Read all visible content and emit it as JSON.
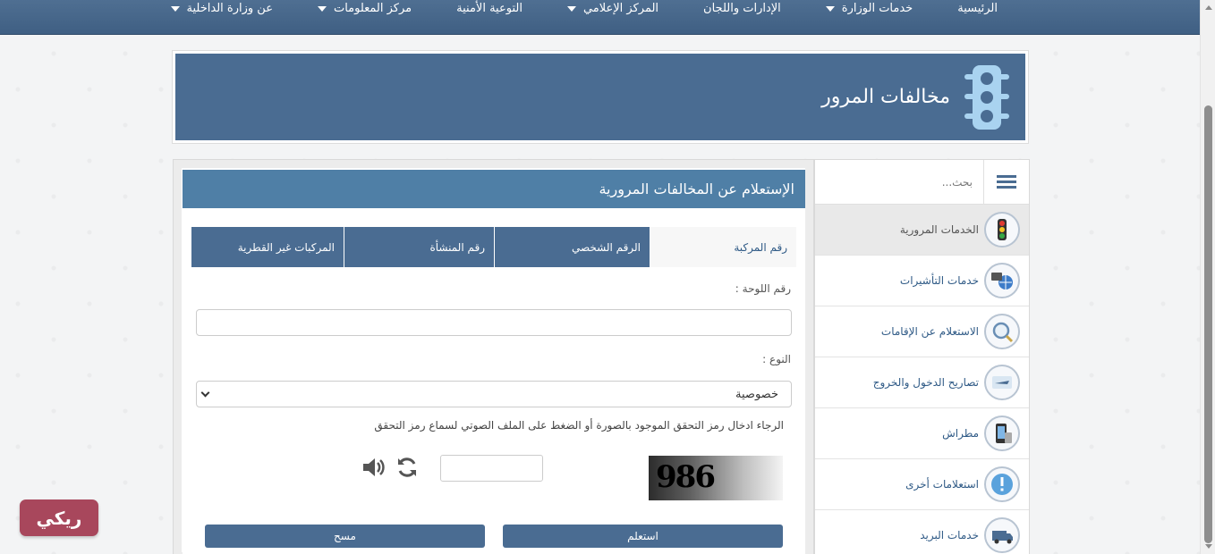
{
  "nav": {
    "items": [
      {
        "label": "الرئيسية",
        "has_caret": false
      },
      {
        "label": "خدمات الوزارة",
        "has_caret": true
      },
      {
        "label": "الإدارات واللجان",
        "has_caret": false
      },
      {
        "label": "المركز الإعلامي",
        "has_caret": true
      },
      {
        "label": "التوعية الأمنية",
        "has_caret": false
      },
      {
        "label": "مركز المعلومات",
        "has_caret": true
      },
      {
        "label": "عن وزارة الداخلية",
        "has_caret": true
      }
    ]
  },
  "banner": {
    "title": "مخالفات المرور",
    "icon": "traffic-light-icon"
  },
  "sidebar": {
    "search_placeholder": "بحث...",
    "items": [
      {
        "label": "الخدمات المرورية",
        "icon": "traffic-light-icon",
        "active": true
      },
      {
        "label": "خدمات التأشيرات",
        "icon": "visa-globe-icon",
        "active": false
      },
      {
        "label": "الاستعلام عن الإقامات",
        "icon": "residency-search-icon",
        "active": false
      },
      {
        "label": "تصاريح الدخول والخروج",
        "icon": "airplane-icon",
        "active": false
      },
      {
        "label": "مطراش",
        "icon": "metrash-phone-icon",
        "active": false
      },
      {
        "label": "استعلامات أخرى",
        "icon": "exclamation-icon",
        "active": false
      },
      {
        "label": "خدمات البريد",
        "icon": "postal-van-icon",
        "active": false
      }
    ]
  },
  "main": {
    "title": "الإستعلام عن المخالفات المرورية",
    "tabs": [
      {
        "label": "رقم المركبة",
        "active": true
      },
      {
        "label": "الرقم الشخصي",
        "active": false
      },
      {
        "label": "رقم المنشأة",
        "active": false
      },
      {
        "label": "المركبات غير القطرية",
        "active": false
      }
    ],
    "plate_label": "رقم اللوحة :",
    "plate_value": "",
    "type_label": "النوع :",
    "type_selected": "خصوصية",
    "captcha_hint": "الرجاء ادخال رمز التحقق الموجود بالصورة أو الضغط على الملف الصوتي لسماع رمز التحقق",
    "captcha_text": "986",
    "captcha_value": "",
    "submit_label": "استعلم",
    "clear_label": "مسح"
  },
  "watermark": {
    "label": "ريكي"
  },
  "colors": {
    "primary": "#4a6c92",
    "title_bar": "#4f7fa6",
    "link": "#2f5a86",
    "logo": "#a8475c"
  }
}
